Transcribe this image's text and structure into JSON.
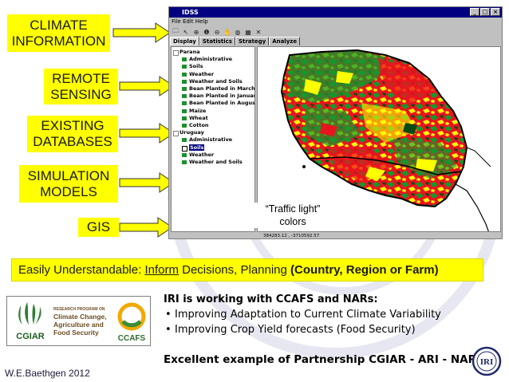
{
  "inputs": [
    {
      "lines": [
        "CLIMATE",
        "INFORMATION"
      ]
    },
    {
      "lines": [
        "REMOTE",
        "SENSING"
      ]
    },
    {
      "lines": [
        "EXISTING",
        "DATABASES"
      ]
    },
    {
      "lines": [
        "SIMULATION",
        "MODELS"
      ]
    },
    {
      "lines": [
        "GIS"
      ]
    }
  ],
  "window": {
    "title": "IDSS",
    "menu": "File  Edit  Help",
    "tabs": [
      "Display",
      "Statistics",
      "Strategy",
      "Analyze"
    ],
    "tree": {
      "group1": "Parana",
      "group1_items": [
        "Administrative",
        "Soils",
        "Weather",
        "Weather and Soils",
        "Bean Planted in March",
        "Bean Planted in January",
        "Bean Planted in August",
        "Maize",
        "Wheat",
        "Cotton"
      ],
      "group2": "Uruguay",
      "group2_items": [
        "Administrative",
        "Soils",
        "Weather",
        "Weather and Soils"
      ],
      "selected_item": "Soils"
    },
    "status_coords": "384283.12 , -3710592.57"
  },
  "traffic_note": {
    "line1": "“Traffic light”",
    "line2": "colors"
  },
  "banner": {
    "prefix": "Easily Understandable:",
    "inform": "Inform",
    "middle": "Decisions, Planning",
    "bold": "(Country, Region or Farm)"
  },
  "logos": {
    "cgiar": "CGIAR",
    "program_lines": [
      "RESEARCH PROGRAM ON",
      "Climate Change,",
      "Agriculture and",
      "Food Security"
    ],
    "ccafs": "CCAFS"
  },
  "bullets": {
    "head": "IRI is working with CCAFS and NARs:",
    "items": [
      "Improving Adaptation to Current Climate Variability",
      "Improving Crop Yield forecasts (Food Security)"
    ]
  },
  "partnership": "Excellent example of Partnership CGIAR - ARI - NARI",
  "credit": "W.E.Baethgen 2012",
  "iri_logo_text": "IRI",
  "colors": {
    "input_box": "#ffff00",
    "map_red": "#e8141e",
    "map_green": "#129a2c",
    "map_yellow": "#ffff00",
    "title_bar": "#000080"
  }
}
